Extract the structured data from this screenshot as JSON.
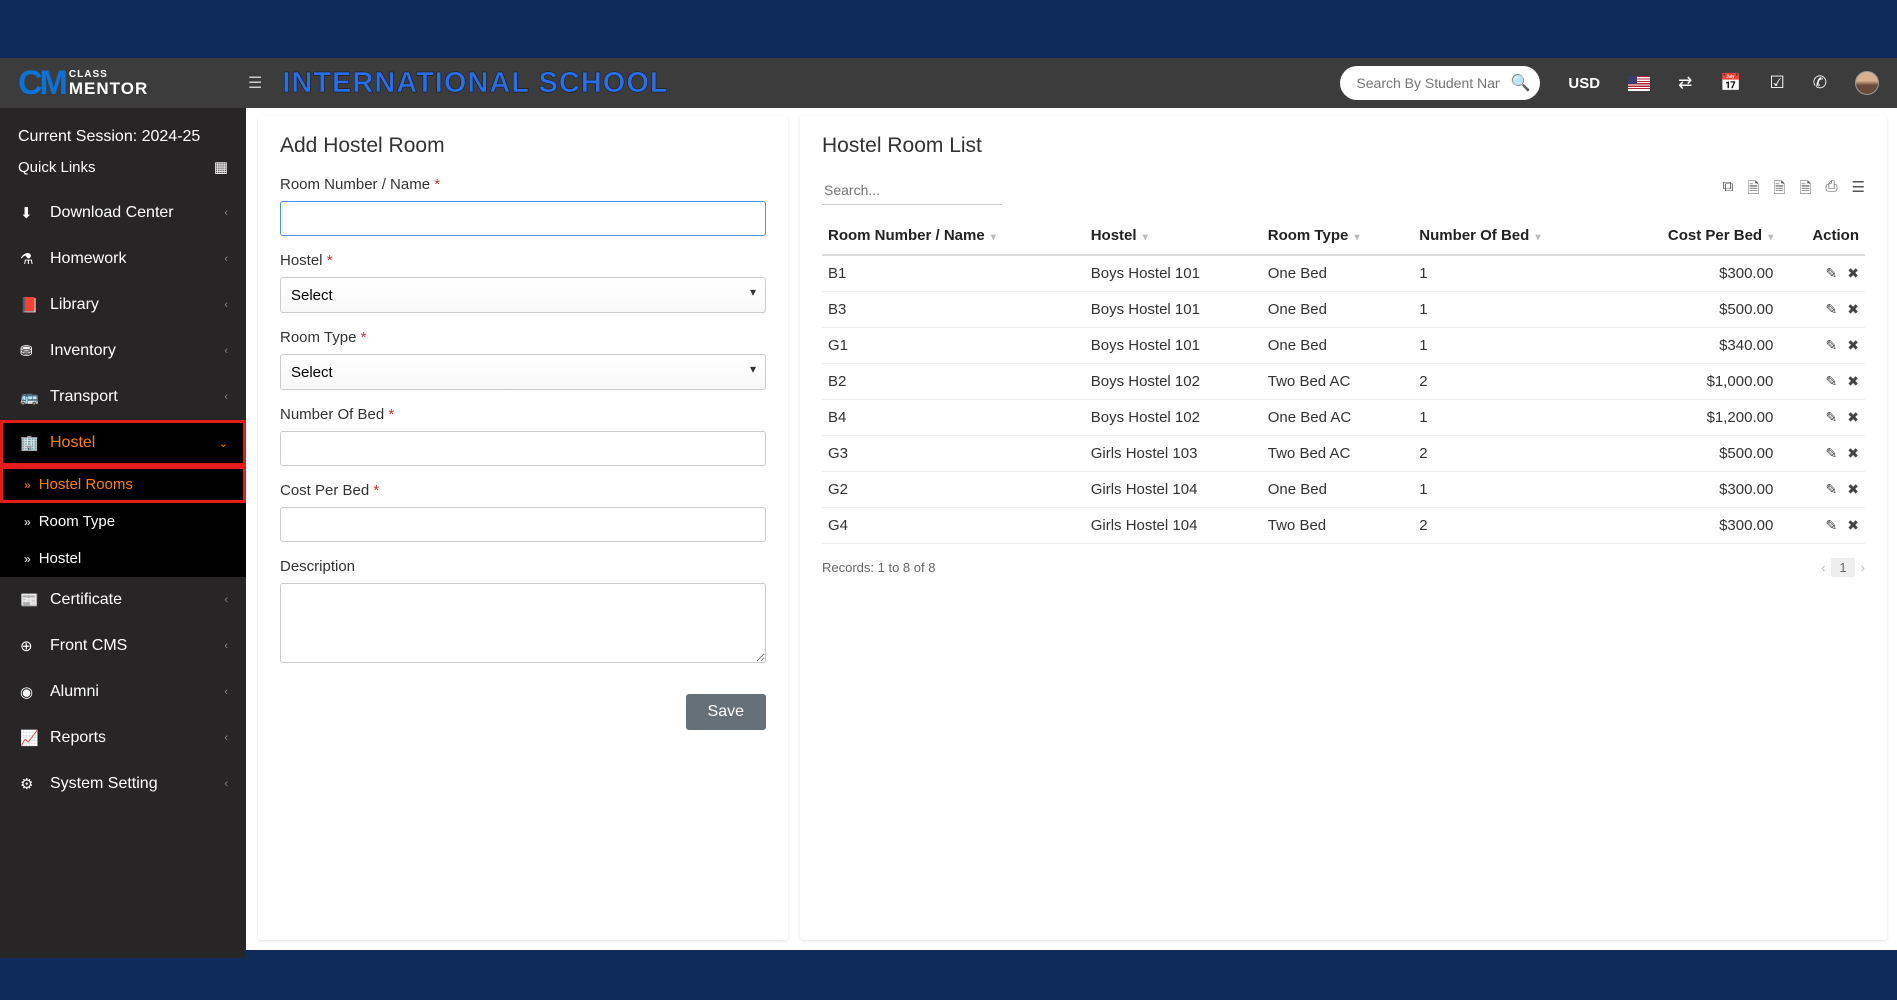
{
  "app": {
    "brand_prefix": "CM",
    "brand_small": "CLASS",
    "brand_big": "MENTOR",
    "title": "INTERNATIONAL SCHOOL",
    "search_placeholder": "Search By Student Name",
    "currency": "USD"
  },
  "sidebar": {
    "session": "Current Session: 2024-25",
    "quick_links": "Quick Links",
    "items": [
      {
        "label": "Download Center"
      },
      {
        "label": "Homework"
      },
      {
        "label": "Library"
      },
      {
        "label": "Inventory"
      },
      {
        "label": "Transport"
      },
      {
        "label": "Hostel"
      },
      {
        "label": "Certificate"
      },
      {
        "label": "Front CMS"
      },
      {
        "label": "Alumni"
      },
      {
        "label": "Reports"
      },
      {
        "label": "System Setting"
      }
    ],
    "sub_hostel": [
      {
        "label": "Hostel Rooms"
      },
      {
        "label": "Room Type"
      },
      {
        "label": "Hostel"
      }
    ]
  },
  "form": {
    "title": "Add Hostel Room",
    "room_number_label": "Room Number / Name",
    "hostel_label": "Hostel",
    "room_type_label": "Room Type",
    "number_of_bed_label": "Number Of Bed",
    "cost_per_bed_label": "Cost Per Bed",
    "description_label": "Description",
    "select_placeholder": "Select",
    "save_label": "Save"
  },
  "list": {
    "title": "Hostel Room List",
    "search_placeholder": "Search...",
    "columns": {
      "room_number": "Room Number / Name",
      "hostel": "Hostel",
      "room_type": "Room Type",
      "number_of_bed": "Number Of Bed",
      "cost_per_bed": "Cost Per Bed",
      "action": "Action"
    },
    "rows": [
      {
        "room": "B1",
        "hostel": "Boys Hostel 101",
        "type": "One Bed",
        "beds": "1",
        "cost": "$300.00"
      },
      {
        "room": "B3",
        "hostel": "Boys Hostel 101",
        "type": "One Bed",
        "beds": "1",
        "cost": "$500.00"
      },
      {
        "room": "G1",
        "hostel": "Boys Hostel 101",
        "type": "One Bed",
        "beds": "1",
        "cost": "$340.00"
      },
      {
        "room": "B2",
        "hostel": "Boys Hostel 102",
        "type": "Two Bed AC",
        "beds": "2",
        "cost": "$1,000.00"
      },
      {
        "room": "B4",
        "hostel": "Boys Hostel 102",
        "type": "One Bed AC",
        "beds": "1",
        "cost": "$1,200.00"
      },
      {
        "room": "G3",
        "hostel": "Girls Hostel 103",
        "type": "Two Bed AC",
        "beds": "2",
        "cost": "$500.00"
      },
      {
        "room": "G2",
        "hostel": "Girls Hostel 104",
        "type": "One Bed",
        "beds": "1",
        "cost": "$300.00"
      },
      {
        "room": "G4",
        "hostel": "Girls Hostel 104",
        "type": "Two Bed",
        "beds": "2",
        "cost": "$300.00"
      }
    ],
    "footer_records": "Records: 1 to 8 of 8",
    "page": "1"
  }
}
